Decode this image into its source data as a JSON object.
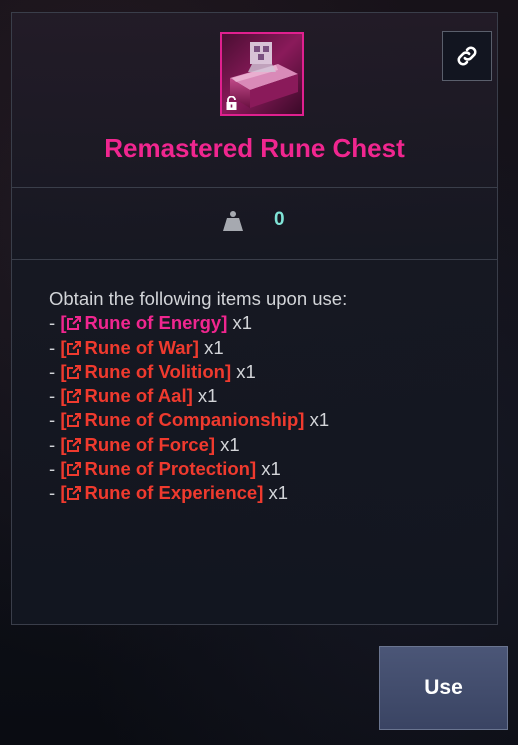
{
  "item": {
    "name": "Remastered Rune Chest",
    "icon": "rune-chest-icon",
    "lock_icon": "lock-icon",
    "rarity_color": "#f0268f"
  },
  "link_button": {
    "icon": "link-icon"
  },
  "weight": {
    "icon": "weight-icon",
    "value": "0"
  },
  "description": {
    "intro": "Obtain the following items upon use:",
    "rewards": [
      {
        "prefix": "- ",
        "name": "Rune of Energy",
        "qty": "x1",
        "color": "#f0268f"
      },
      {
        "prefix": "- ",
        "name": "Rune of War",
        "qty": "x1",
        "color": "#ef3a2e"
      },
      {
        "prefix": "- ",
        "name": "Rune of Volition",
        "qty": "x1",
        "color": "#ef3a2e"
      },
      {
        "prefix": "- ",
        "name": "Rune of Aal",
        "qty": "x1",
        "color": "#ef3a2e"
      },
      {
        "prefix": "- ",
        "name": "Rune of Companionship",
        "qty": "x1",
        "color": "#ef3a2e"
      },
      {
        "prefix": "- ",
        "name": "Rune of Force",
        "qty": "x1",
        "color": "#ef3a2e"
      },
      {
        "prefix": "- ",
        "name": "Rune of Protection",
        "qty": "x1",
        "color": "#ef3a2e"
      },
      {
        "prefix": "- ",
        "name": "Rune of Experience",
        "qty": "x1",
        "color": "#ef3a2e"
      }
    ]
  },
  "actions": {
    "use_label": "Use"
  }
}
